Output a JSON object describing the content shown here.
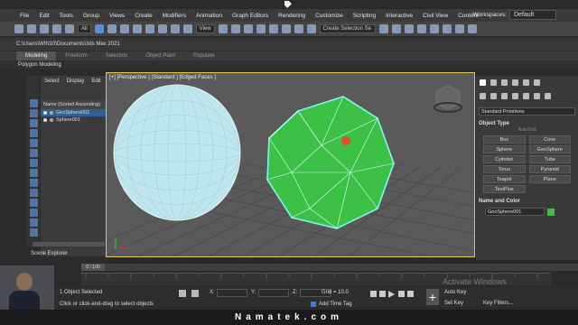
{
  "menu": [
    "File",
    "Edit",
    "Tools",
    "Group",
    "Views",
    "Create",
    "Modifiers",
    "Animation",
    "Graph Editors",
    "Rendering",
    "Customize",
    "Scripting",
    "Interactive",
    "Civil View",
    "Content"
  ],
  "workspace": {
    "label": "Workspaces:",
    "value": "Default"
  },
  "toolbar": {
    "filter_value": "All",
    "view_value": "View",
    "selection_set": "Create Selection Se"
  },
  "path": {
    "value": "C:\\Users\\WIN10\\Documents\\3ds Max 2021"
  },
  "ribbon": {
    "tabs": [
      "Modeling",
      "Freeform",
      "Selection",
      "Object Paint",
      "Populate"
    ],
    "active_index": 0,
    "sub_label": "Polygon Modeling"
  },
  "scene_explorer": {
    "tabs": [
      "Select",
      "Display",
      "Edit"
    ],
    "header": "Name (Sorted Ascending)",
    "items": [
      "GeoSphere001",
      "Sphere001"
    ],
    "title": "Scene Explorer"
  },
  "viewport": {
    "label": "[+] [Perspective ] [Standard ] [Edged Faces ]"
  },
  "command_panel": {
    "dropdown": "Standard Primitives",
    "object_type_title": "Object Type",
    "autogrid": "AutoGrid",
    "buttons": [
      "Box",
      "Cone",
      "Sphere",
      "GeoSphere",
      "Cylinder",
      "Tube",
      "Torus",
      "Pyramid",
      "Teapot",
      "Plane",
      "TextPlus"
    ],
    "name_color_title": "Name and Color",
    "name_value": "GeoSphere001",
    "color": "#3cc146"
  },
  "timeline": {
    "frame": "0 / 100"
  },
  "status": {
    "selection": "1 Object Selected",
    "prompt": "Click or click-and-drag to select objects",
    "grid": "Grid = 10.0",
    "add_time_tag": "Add Time Tag",
    "auto_key": "Auto Key",
    "set_key": "Set Key",
    "key_filters": "Key Filters...",
    "x_label": "X:",
    "y_label": "Y:",
    "z_label": "Z:"
  },
  "watermark": "Activate Windows",
  "brand": "Namatek.com"
}
